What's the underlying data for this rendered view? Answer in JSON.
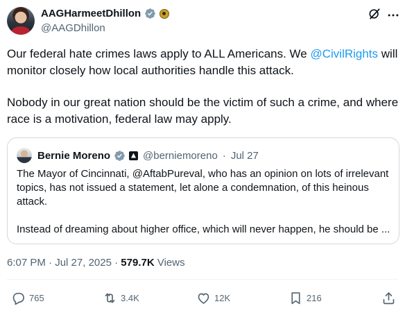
{
  "author": {
    "display_name": "AAGHarmeetDhillon",
    "handle": "@AAGDhillon"
  },
  "tweet": {
    "line_prefix": "Our federal hate crimes laws apply to ALL Americans. We ",
    "mention": "@CivilRights",
    "line_suffix": " will monitor closely how local authorities handle this attack.",
    "paragraph_2": "Nobody in our great nation should be the victim of such a crime, and where race is a motivation, federal law may apply."
  },
  "quote": {
    "name": "Bernie Moreno",
    "handle": "@berniemoreno",
    "separator": "·",
    "date": "Jul 27",
    "paragraph_1": "The Mayor of Cincinnati, @AftabPureval, who has an opinion on lots of irrelevant topics, has not issued a statement, let alone a condemnation, of this heinous attack.",
    "paragraph_2": "Instead of dreaming about higher office, which will never happen, he should be ..."
  },
  "meta": {
    "time": "6:07 PM",
    "separator": "·",
    "date": "Jul 27, 2025",
    "views_count": "579.7K",
    "views_label": "Views"
  },
  "actions": {
    "replies": "765",
    "reposts": "3.4K",
    "likes": "12K",
    "bookmarks": "216"
  },
  "colors": {
    "link": "#1d9bf0",
    "verified": "#829aab",
    "secondary_text": "#536471",
    "border": "#cfd9de"
  },
  "icons": [
    "verified-badge-icon",
    "affiliate-seal-icon",
    "grok-icon",
    "more-icon",
    "reply-icon",
    "repost-icon",
    "like-icon",
    "bookmark-icon",
    "share-icon"
  ]
}
